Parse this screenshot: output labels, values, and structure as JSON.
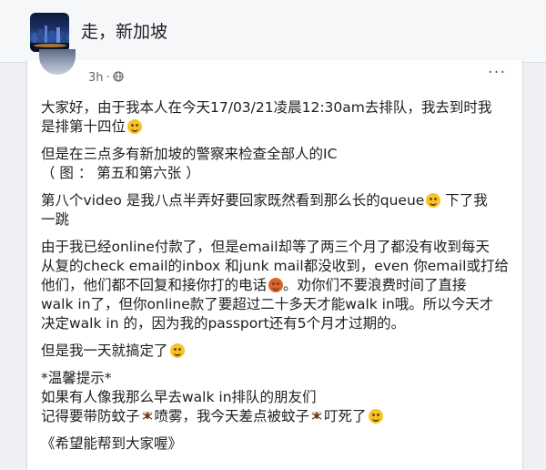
{
  "group": {
    "name": "走，新加坡"
  },
  "post": {
    "time": "3h",
    "time_separator": "·",
    "privacy_icon": "globe-icon",
    "more_icon": "more-options-icon",
    "more_glyph": "···",
    "paragraphs": [
      {
        "lines": [
          {
            "text": "大家好，由于我本人在今天17/03/21凌晨12:30am去排队，我去到时我"
          },
          {
            "text": "是排第十四位",
            "emoji": "rolling-eyes-emoji"
          }
        ]
      },
      {
        "lines": [
          {
            "text": "但是在三点多有新加坡的警察来检查全部人的IC"
          },
          {
            "text": "（ 图 ： 第五和第六张 ）"
          }
        ]
      },
      {
        "lines": [
          {
            "text": "第八个video 是我八点半弄好要回家既然看到那么长的queue",
            "emoji": "grinning-emoji",
            "after": " 下了我"
          },
          {
            "text": "一跳"
          }
        ]
      },
      {
        "lines": [
          {
            "text": "由于我已经online付款了，但是email却等了两三个月了都没有收到每天"
          },
          {
            "text": "从复的check email的inbox 和junk mail都没收到，even 你email或打给"
          },
          {
            "text": "他们，他们都不回复和接你打的电话",
            "emoji": "angry-emoji",
            "after": "。劝你们不要浪费时间了直接"
          },
          {
            "text": "walk in了，但你online款了要超过二十多天才能walk in哦。所以今天才"
          },
          {
            "text": "决定walk in 的，因为我的passport还有5个月才过期的。"
          }
        ]
      },
      {
        "lines": [
          {
            "text": "但是我一天就搞定了",
            "emoji": "relieved-emoji"
          }
        ]
      },
      {
        "lines": [
          {
            "text": "*温馨提示*"
          },
          {
            "text": "如果有人像我那么早去walk in排队的朋友们"
          },
          {
            "text": "记得要带防蚊子",
            "icon": "mosquito-icon",
            "after": "喷雾，我今天差点被蚊子",
            "icon2": "mosquito-icon",
            "after2": "叮死了",
            "emoji": "grinning-emoji"
          }
        ]
      },
      {
        "lines": [
          {
            "text": "《希望能帮到大家喔》"
          }
        ]
      }
    ]
  },
  "colors": {
    "page_bg": "#eef0f3",
    "card_bg": "#ffffff",
    "text": "#1c1e21",
    "meta_text": "#65676b",
    "emoji_yellow": "#f7c325",
    "emoji_angry": "#e0602a"
  }
}
